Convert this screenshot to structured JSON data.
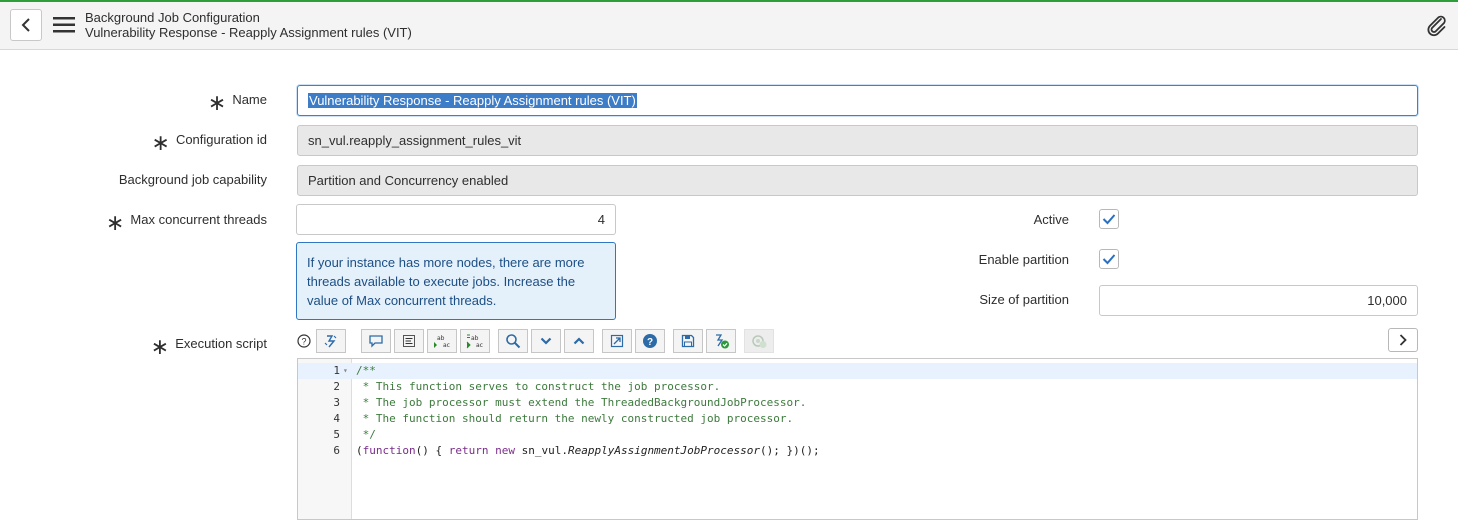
{
  "header": {
    "title": "Background Job Configuration",
    "subtitle": "Vulnerability Response - Reapply Assignment rules (VIT)",
    "icons": {
      "back": "chevron-left-icon",
      "menu": "hamburger-icon",
      "attachment": "paperclip-icon"
    }
  },
  "form": {
    "name": {
      "label": "Name",
      "value": "Vulnerability Response - Reapply Assignment rules (VIT)",
      "required": true
    },
    "config_id": {
      "label": "Configuration id",
      "value": "sn_vul.reapply_assignment_rules_vit",
      "required": true
    },
    "capability": {
      "label": "Background job capability",
      "value": "Partition and Concurrency enabled"
    },
    "max_threads": {
      "label": "Max concurrent threads",
      "value": "4",
      "required": true
    },
    "info": "If your instance has more nodes, there are more threads available to execute jobs. Increase the value of Max concurrent threads.",
    "active": {
      "label": "Active",
      "checked": true
    },
    "enable_partition": {
      "label": "Enable partition",
      "checked": true
    },
    "partition_size": {
      "label": "Size of partition",
      "value": "10,000"
    },
    "script": {
      "label": "Execution script",
      "required": true
    }
  },
  "toolbar": {
    "buttons": [
      "format-code-icon",
      "comment-icon",
      "format-block-icon",
      "replace-icon",
      "replace-all-icon",
      "search-icon",
      "next-icon",
      "previous-icon",
      "fullscreen-icon",
      "help-circle-icon",
      "save-icon",
      "script-check-icon",
      "debug-icon"
    ]
  },
  "editor": {
    "lines": [
      {
        "n": "1",
        "text": "/**",
        "kind": "comment"
      },
      {
        "n": "2",
        "text": " * This function serves to construct the job processor.",
        "kind": "comment"
      },
      {
        "n": "3",
        "text": " * The job processor must extend the ThreadedBackgroundJobProcessor.",
        "kind": "comment"
      },
      {
        "n": "4",
        "text": " * The function should return the newly constructed job processor.",
        "kind": "comment"
      },
      {
        "n": "5",
        "text": " */",
        "kind": "comment"
      },
      {
        "n": "6",
        "text": "(function() { return new sn_vul.ReapplyAssignmentJobProcessor(); })();",
        "kind": "code"
      }
    ],
    "code_tokens": {
      "open": "(",
      "kw_function": "function",
      "mid1": "() { ",
      "kw_return": "return",
      "sp1": " ",
      "kw_new": "new",
      "ns": " sn_vul.",
      "cls": "ReapplyAssignmentJobProcessor",
      "tail": "(); })();"
    }
  }
}
